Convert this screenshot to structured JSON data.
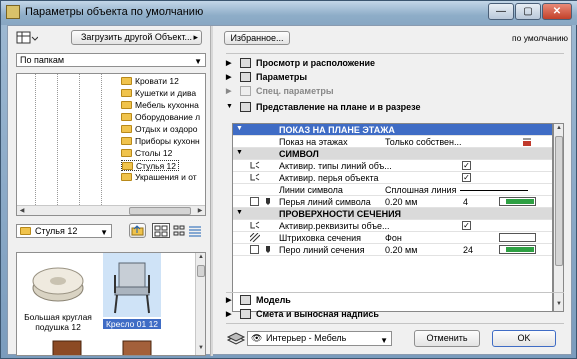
{
  "window": {
    "title": "Параметры объекта по умолчанию",
    "controls": [
      "—",
      "▢",
      "✕"
    ]
  },
  "left": {
    "load_button": "Загрузить другой Объект...",
    "folder_mode": "По папкам",
    "tree_items": [
      "Кровати 12",
      "Кушетки и дива",
      "Мебель кухонна",
      "Оборудование л",
      "Отдых и оздоро",
      "Приборы кухонн",
      "Столы 12",
      "Стулья 12",
      "Украшения и от"
    ],
    "tree_selected_index": 7,
    "current_folder": "Стулья 12",
    "previews": [
      {
        "caption": "Большая круглая подушка 12"
      },
      {
        "caption": "Кресло 01 12"
      }
    ]
  },
  "right": {
    "favorites_button": "Избранное...",
    "default_label": "по умолчанию",
    "sections": [
      {
        "label": "Просмотр и расположение",
        "state": "collapsed"
      },
      {
        "label": "Параметры",
        "state": "collapsed"
      },
      {
        "label": "Спец. параметры",
        "state": "disabled"
      },
      {
        "label": "Представление на плане и в разрезе",
        "state": "expanded"
      }
    ],
    "grid": {
      "header": "ПОКАЗ НА ПЛАНЕ ЭТАЖА",
      "rows": [
        {
          "type": "row",
          "label": "Показ на этажах",
          "value": "Только собствен..."
        },
        {
          "type": "group",
          "label": "СИМВОЛ"
        },
        {
          "type": "row",
          "label": "Активир. типы линий объ...",
          "checked": true
        },
        {
          "type": "row",
          "label": "Активир. перья объекта",
          "checked": true
        },
        {
          "type": "row",
          "label": "Линии символа",
          "value": "Сплошная линия"
        },
        {
          "type": "row",
          "label": "Перья линий символа",
          "value": "0.20 мм",
          "pen": "4"
        },
        {
          "type": "group",
          "label": "ПРОВЕРХНОСТИ СЕЧЕНИЯ"
        },
        {
          "type": "row",
          "label": "Активир.реквизиты объе...",
          "checked": true
        },
        {
          "type": "row",
          "label": "Штриховка сечения",
          "value": "Фон"
        },
        {
          "type": "row",
          "label": "Перо линий сечения",
          "value": "0.20 мм",
          "pen": "24"
        }
      ]
    },
    "bottom_sections": [
      {
        "label": "Модель"
      },
      {
        "label": "Смета и выносная надпись"
      }
    ],
    "layer_select": "Интерьер - Мебель",
    "cancel_button": "Отменить",
    "ok_button": "OK",
    "pen_color": "#2ea043",
    "header_color": "#3f6cc5"
  }
}
